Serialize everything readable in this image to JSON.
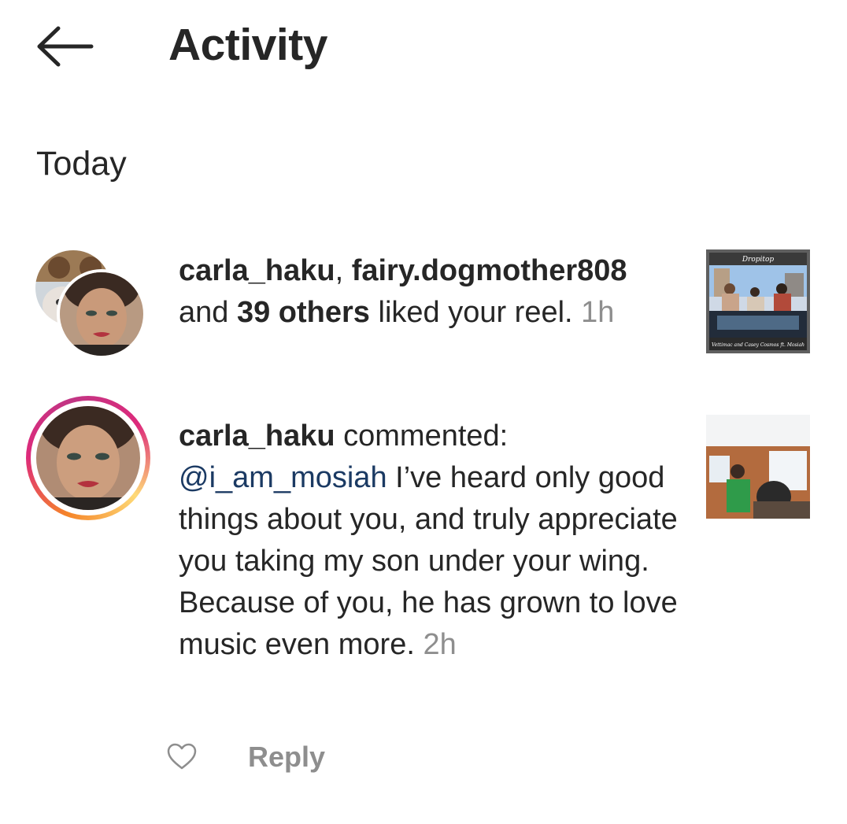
{
  "header": {
    "back_icon": "arrow-left-icon",
    "title": "Activity"
  },
  "section": {
    "label": "Today"
  },
  "notifications": [
    {
      "users": [
        "carla_haku",
        "fairy.dogmother808"
      ],
      "separator": ", ",
      "and": "and ",
      "others": "39 others",
      "action": " liked your reel. ",
      "time": "1h",
      "thumbnail": {
        "title": "Dropitop",
        "caption": "Vettimac and Casey Cosmos ft. Mosiah"
      }
    },
    {
      "user": "carla_haku",
      "action": " commented:",
      "mention": "@i_am_mosiah",
      "comment": " I’ve heard only good things about you, and truly appreciate you taking my son under your wing. Because of you, he has grown to love music even more. ",
      "time": "2h",
      "like_icon": "heart-outline-icon",
      "reply_label": "Reply"
    }
  ],
  "colors": {
    "text": "#262626",
    "muted": "#8e8e8e",
    "mention": "#1b3a63",
    "story_ring": [
      "#f58529",
      "#dd2a7b",
      "#feda77"
    ]
  }
}
